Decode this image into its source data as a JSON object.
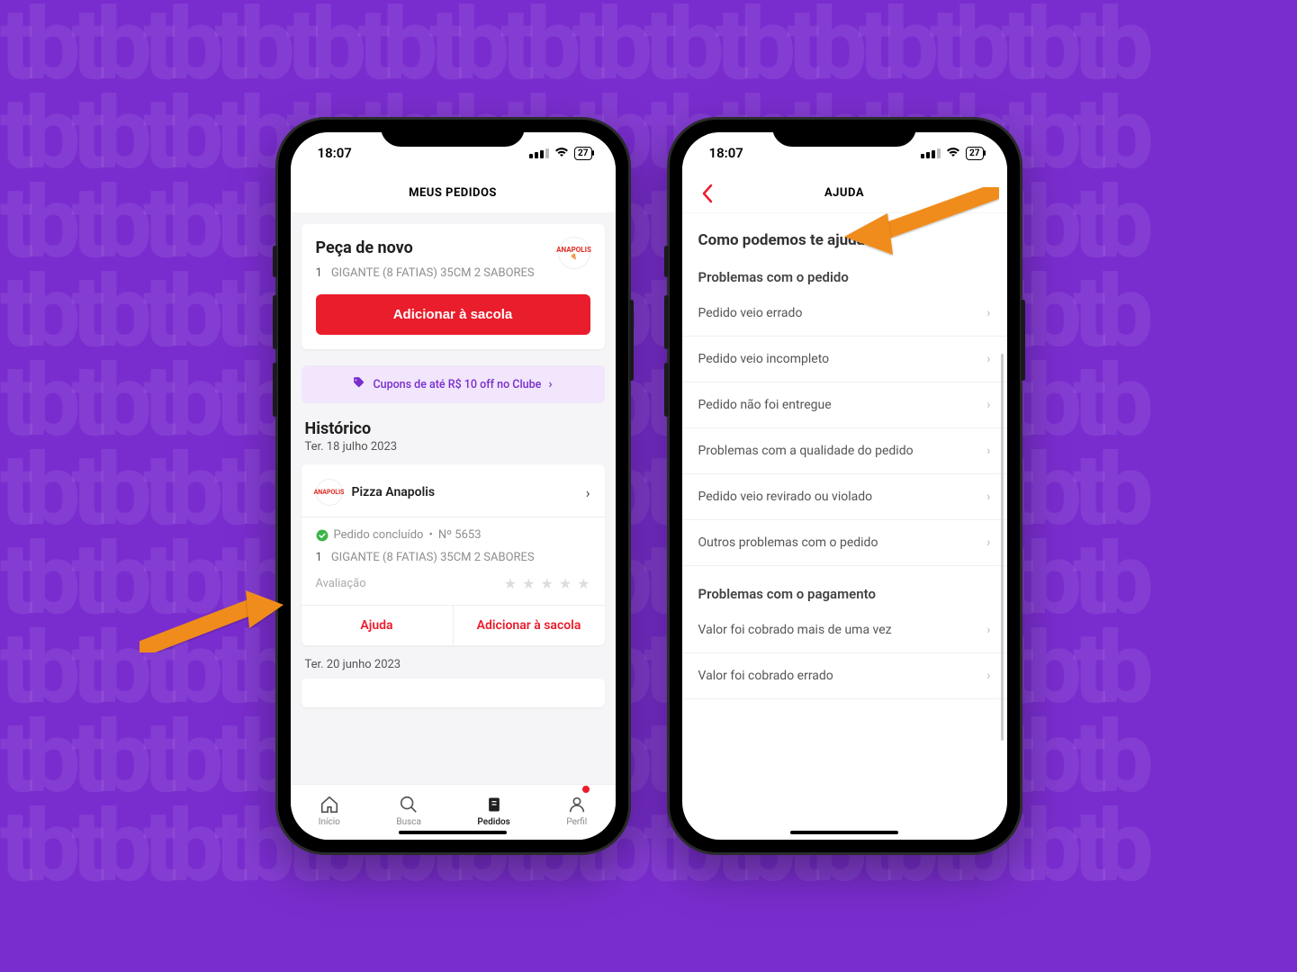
{
  "status": {
    "time": "18:07",
    "battery": "27"
  },
  "left": {
    "title": "MEUS PEDIDOS",
    "reorder": {
      "title": "Peça de novo",
      "qty": "1",
      "item": "GIGANTE (8 FATIAS) 35CM 2 SABORES",
      "button": "Adicionar à sacola",
      "restaurant_logo": "ANAPOLIS"
    },
    "promo": "Cupons de até R$ 10 off no Clube",
    "history": {
      "title": "Histórico",
      "date1": "Ter. 18 julho 2023",
      "order": {
        "restaurant": "Pizza Anapolis",
        "status": "Pedido concluído",
        "number": "Nº 5653",
        "qty": "1",
        "item": "GIGANTE (8 FATIAS) 35CM 2 SABORES",
        "rating_label": "Avaliação",
        "help": "Ajuda",
        "reorder": "Adicionar à sacola"
      },
      "date2": "Ter. 20 junho 2023"
    },
    "tabs": {
      "home": "Início",
      "search": "Busca",
      "orders": "Pedidos",
      "profile": "Perfil"
    }
  },
  "right": {
    "title": "AJUDA",
    "question": "Como podemos te ajudar?",
    "group1": "Problemas com o pedido",
    "items1": [
      "Pedido veio errado",
      "Pedido veio incompleto",
      "Pedido não foi entregue",
      "Problemas com a qualidade do pedido",
      "Pedido veio revirado ou violado",
      "Outros problemas com o pedido"
    ],
    "group2": "Problemas com o pagamento",
    "items2": [
      "Valor foi cobrado mais de uma vez",
      "Valor foi cobrado errado"
    ]
  }
}
